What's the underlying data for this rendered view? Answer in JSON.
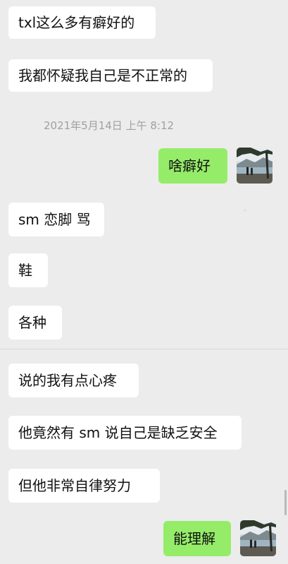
{
  "messages": [
    {
      "side": "left",
      "text": "txl这么多有癖好的"
    },
    {
      "side": "left",
      "text": "我都怀疑我自己是不正常的"
    },
    {
      "side": "right",
      "text": "啥癖好"
    },
    {
      "side": "left",
      "text": "sm 恋脚 骂"
    },
    {
      "side": "left",
      "text": "鞋"
    },
    {
      "side": "left",
      "text": "各种"
    },
    {
      "side": "left",
      "text": "说的我有点心疼"
    },
    {
      "side": "left",
      "text": "他竟然有 sm 说自己是缺乏安全"
    },
    {
      "side": "left",
      "text": "但他非常自律努力"
    },
    {
      "side": "right",
      "text": "能理解"
    }
  ],
  "timestamp": "2021年5月14日 上午 8:12",
  "avatar": {
    "icon": "lakeside-photo-avatar"
  },
  "colors": {
    "background": "#ececec",
    "incoming_bubble": "#ffffff",
    "outgoing_bubble": "#95ec69",
    "timestamp_text": "#a0a0a0"
  }
}
